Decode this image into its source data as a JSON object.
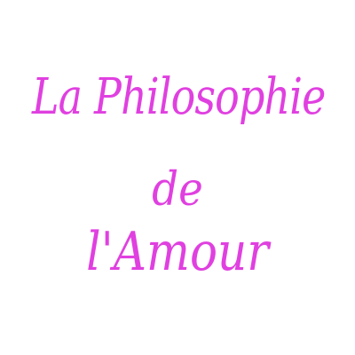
{
  "title": {
    "line1": "La Philosophie",
    "line2": "de",
    "line3": "l'Amour"
  },
  "colors": {
    "text": "#e040e0",
    "background": "#ffffff"
  }
}
